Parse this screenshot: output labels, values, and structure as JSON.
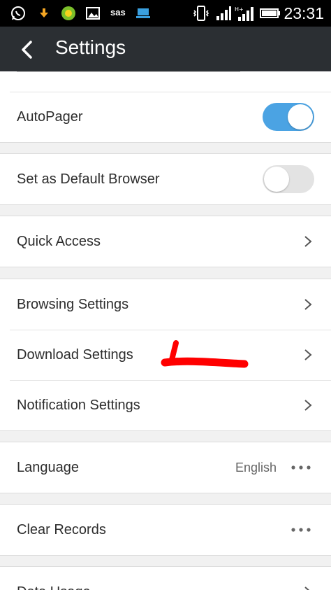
{
  "status_bar": {
    "time": "23:31",
    "carrier_text": "sas",
    "icons": [
      "whatsapp-icon",
      "download-icon",
      "app-icon",
      "gallery-icon",
      "notification-icon",
      "monitor-icon",
      "vibrate-icon",
      "signal-icon",
      "signal-h-plus-icon",
      "battery-icon"
    ]
  },
  "app_bar": {
    "title": "Settings"
  },
  "rows": {
    "autopager": {
      "label": "AutoPager",
      "enabled": true
    },
    "default_browser": {
      "label": "Set as Default Browser",
      "enabled": false
    },
    "quick_access": {
      "label": "Quick Access"
    },
    "browsing_settings": {
      "label": "Browsing Settings"
    },
    "download_settings": {
      "label": "Download Settings"
    },
    "notification_settings": {
      "label": "Notification Settings"
    },
    "language": {
      "label": "Language",
      "value": "English"
    },
    "clear_records": {
      "label": "Clear Records"
    },
    "data_usage": {
      "label": "Data Usage"
    }
  },
  "colors": {
    "toggle_on": "#4ba3e3",
    "app_bar": "#2b2f33",
    "annotation": "#ff0000"
  }
}
